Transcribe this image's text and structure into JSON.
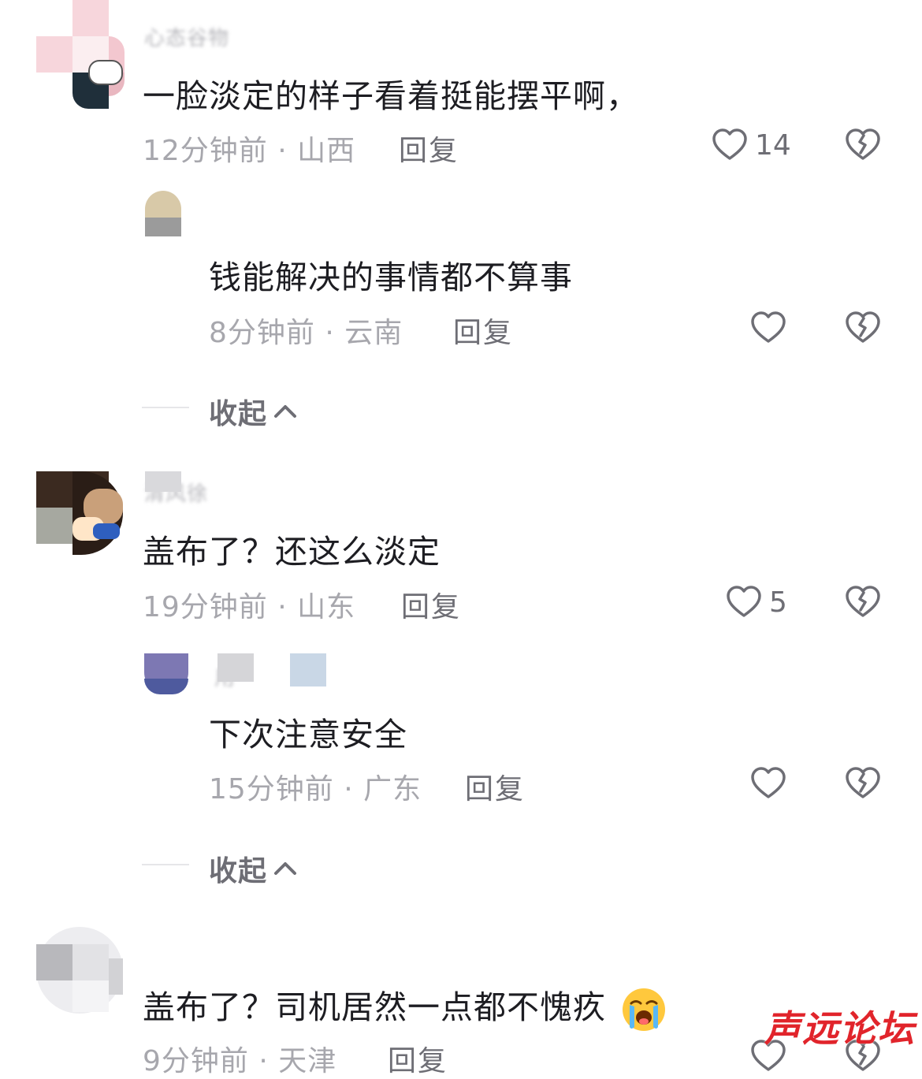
{
  "comments": [
    {
      "username": "心态谷物",
      "text": "一脸淡定的样子看着挺能摆平啊，",
      "time": "12分钟前",
      "location": "山西",
      "reply_label": "回复",
      "likes": "14",
      "replies": [
        {
          "username": "",
          "text": "钱能解决的事情都不算事",
          "time": "8分钟前",
          "location": "云南",
          "reply_label": "回复",
          "likes": ""
        }
      ],
      "collapse_label": "收起"
    },
    {
      "username": "清风徐",
      "text": "盖布了？还这么淡定",
      "time": "19分钟前",
      "location": "山东",
      "reply_label": "回复",
      "likes": "5",
      "replies": [
        {
          "username": "用",
          "text": "下次注意安全",
          "time": "15分钟前",
          "location": "广东",
          "reply_label": "回复",
          "likes": ""
        }
      ],
      "collapse_label": "收起"
    },
    {
      "username": "",
      "text": "盖布了？司机居然一点都不愧疚",
      "emoji": "loudly-crying-face",
      "time": "9分钟前",
      "location": "天津",
      "reply_label": "回复"
    }
  ],
  "watermark": "声远论坛",
  "icons": {
    "like": "heart-outline-icon",
    "dislike": "broken-heart-icon",
    "collapse": "chevron-up-icon"
  },
  "colors": {
    "text": "#1d1d22",
    "meta": "#a7a7ad",
    "action": "#6e6e75",
    "watermark": "#e1242b"
  }
}
